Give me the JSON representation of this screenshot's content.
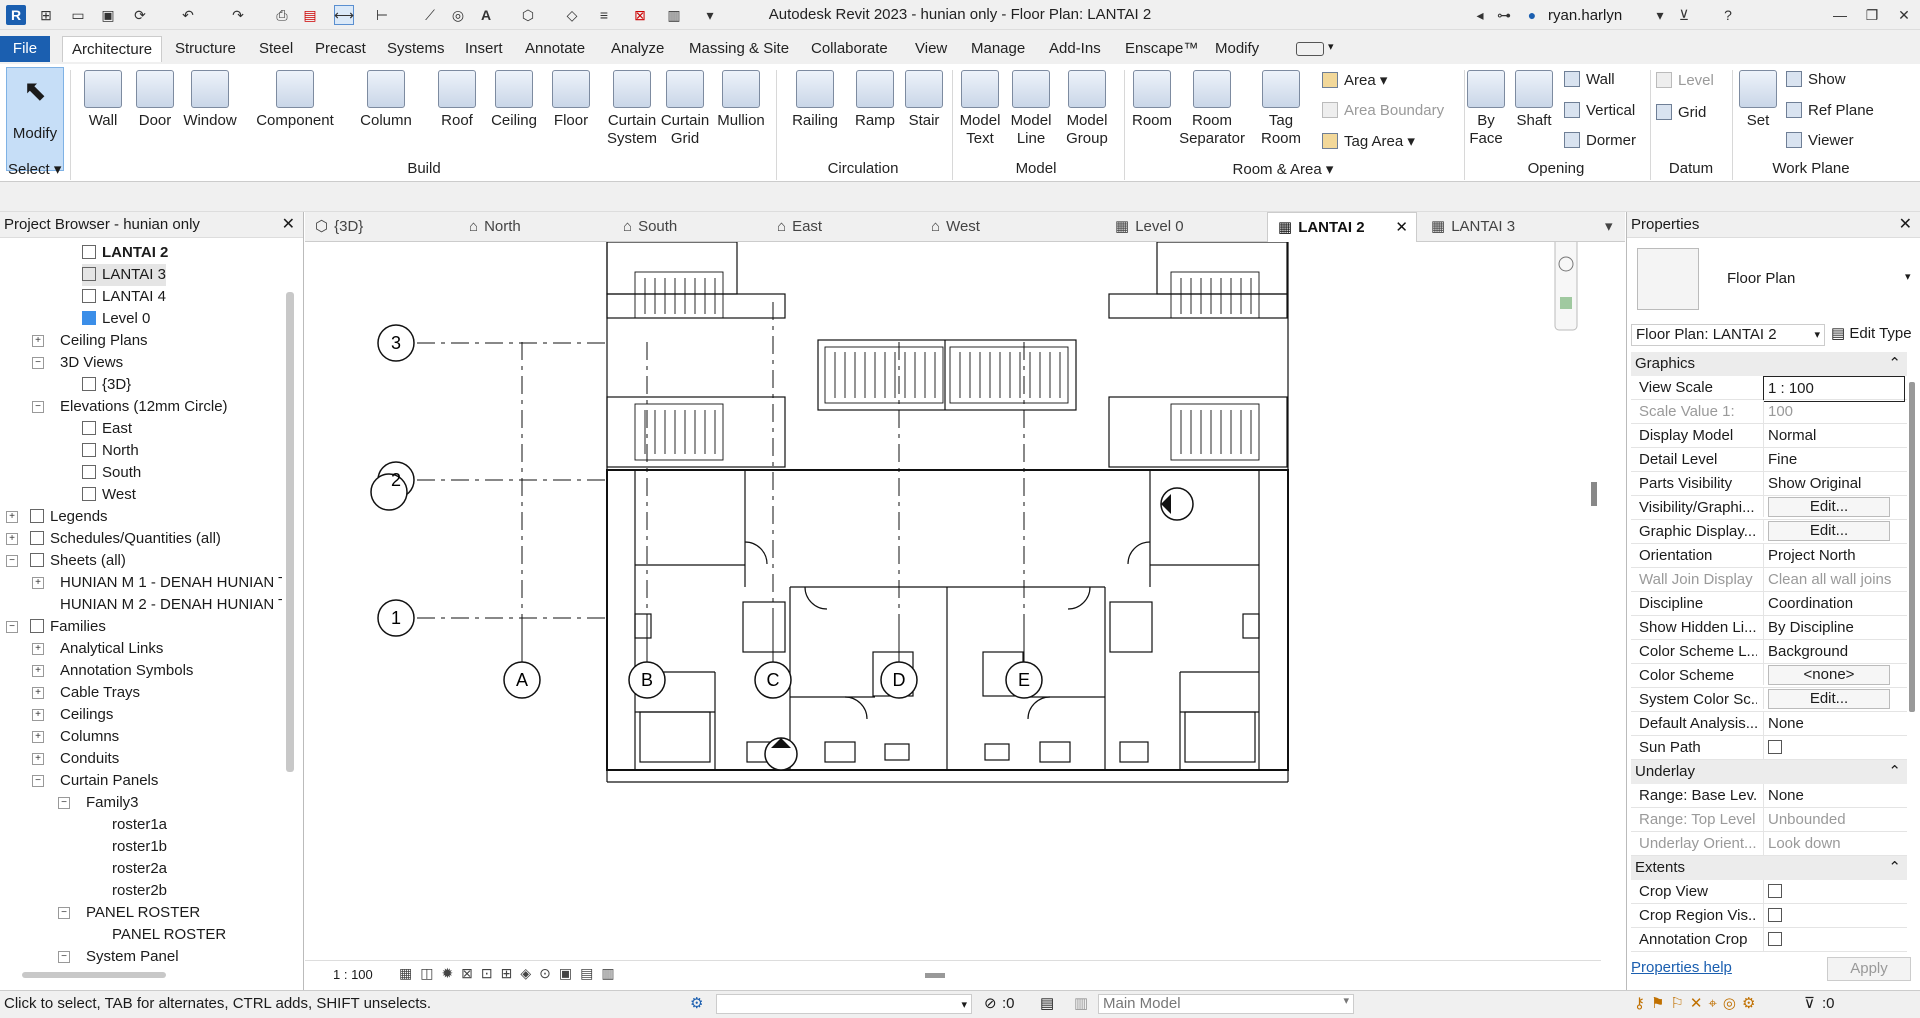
{
  "app": {
    "title": "Autodesk Revit 2023 - hunian only - Floor Plan: LANTAI 2",
    "user": "ryan.harlyn"
  },
  "ribbon_tabs": [
    "File",
    "Architecture",
    "Structure",
    "Steel",
    "Precast",
    "Systems",
    "Insert",
    "Annotate",
    "Analyze",
    "Massing & Site",
    "Collaborate",
    "View",
    "Manage",
    "Add-Ins",
    "Enscape™",
    "Modify"
  ],
  "active_tab": "Architecture",
  "ribbon": {
    "modify": "Modify",
    "select": "Select",
    "build": {
      "wall": "Wall",
      "door": "Door",
      "window": "Window",
      "component": "Component",
      "column": "Column",
      "roof": "Roof",
      "ceiling": "Ceiling",
      "floor": "Floor",
      "curtain_system": "Curtain System",
      "curtain_grid": "Curtain Grid",
      "mullion": "Mullion",
      "label": "Build"
    },
    "circulation": {
      "railing": "Railing",
      "ramp": "Ramp",
      "stair": "Stair",
      "label": "Circulation"
    },
    "model": {
      "model_text": "Model Text",
      "model_line": "Model Line",
      "model_group": "Model Group",
      "label": "Model"
    },
    "room_area": {
      "room": "Room",
      "room_separator": "Room Separator",
      "tag_room": "Tag Room",
      "area": "Area",
      "area_boundary": "Area Boundary",
      "tag_area": "Tag Area",
      "label": "Room & Area"
    },
    "opening": {
      "by_face": "By Face",
      "shaft": "Shaft",
      "wall": "Wall",
      "vertical": "Vertical",
      "dormer": "Dormer",
      "label": "Opening"
    },
    "datum": {
      "level": "Level",
      "grid": "Grid",
      "label": "Datum"
    },
    "work_plane": {
      "set": "Set",
      "show": "Show",
      "ref_plane": "Ref Plane",
      "viewer": "Viewer",
      "label": "Work Plane"
    }
  },
  "project_browser": {
    "title": "Project Browser - hunian only",
    "items": [
      {
        "label": "LANTAI 2",
        "bold": true
      },
      {
        "label": "LANTAI 3"
      },
      {
        "label": "LANTAI 4"
      },
      {
        "label": "Level 0"
      },
      {
        "label": "Ceiling Plans"
      },
      {
        "label": "3D Views"
      },
      {
        "label": "{3D}"
      },
      {
        "label": "Elevations (12mm Circle)"
      },
      {
        "label": "East"
      },
      {
        "label": "North"
      },
      {
        "label": "South"
      },
      {
        "label": "West"
      },
      {
        "label": "Legends"
      },
      {
        "label": "Schedules/Quantities (all)"
      },
      {
        "label": "Sheets (all)"
      },
      {
        "label": "HUNIAN M 1 - DENAH HUNIAN T"
      },
      {
        "label": "HUNIAN M 2 - DENAH HUNIAN T"
      },
      {
        "label": "Families"
      },
      {
        "label": "Analytical Links"
      },
      {
        "label": "Annotation Symbols"
      },
      {
        "label": "Cable Trays"
      },
      {
        "label": "Ceilings"
      },
      {
        "label": "Columns"
      },
      {
        "label": "Conduits"
      },
      {
        "label": "Curtain Panels"
      },
      {
        "label": "Family3"
      },
      {
        "label": "roster1a"
      },
      {
        "label": "roster1b"
      },
      {
        "label": "roster2a"
      },
      {
        "label": "roster2b"
      },
      {
        "label": "PANEL ROSTER"
      },
      {
        "label": "PANEL ROSTER"
      },
      {
        "label": "System Panel"
      }
    ]
  },
  "view_tabs": [
    "{3D}",
    "North",
    "South",
    "East",
    "West",
    "Level 0",
    "LANTAI 2",
    "LANTAI 3"
  ],
  "active_view": "LANTAI 2",
  "canvas": {
    "grid_rows": [
      "3",
      "2",
      "1"
    ],
    "grid_cols": [
      "A",
      "B",
      "C",
      "D",
      "E"
    ]
  },
  "view_scale": "1 : 100",
  "properties": {
    "title": "Properties",
    "type": "Floor Plan",
    "instance": "Floor Plan: LANTAI 2",
    "edit_type": "Edit Type",
    "sections": {
      "graphics": "Graphics",
      "underlay": "Underlay",
      "extents": "Extents"
    },
    "graphics_rows": [
      {
        "k": "View Scale",
        "v": "1 : 100"
      },
      {
        "k": "Scale Value    1:",
        "v": "100"
      },
      {
        "k": "Display Model",
        "v": "Normal"
      },
      {
        "k": "Detail Level",
        "v": "Fine"
      },
      {
        "k": "Parts Visibility",
        "v": "Show Original"
      },
      {
        "k": "Visibility/Graphi...",
        "v": "Edit..."
      },
      {
        "k": "Graphic Display...",
        "v": "Edit..."
      },
      {
        "k": "Orientation",
        "v": "Project North"
      },
      {
        "k": "Wall Join Display",
        "v": "Clean all wall joins"
      },
      {
        "k": "Discipline",
        "v": "Coordination"
      },
      {
        "k": "Show Hidden Li...",
        "v": "By Discipline"
      },
      {
        "k": "Color Scheme L...",
        "v": "Background"
      },
      {
        "k": "Color Scheme",
        "v": "<none>"
      },
      {
        "k": "System Color Sc...",
        "v": "Edit..."
      },
      {
        "k": "Default Analysis...",
        "v": "None"
      },
      {
        "k": "Sun Path",
        "v": ""
      }
    ],
    "underlay_rows": [
      {
        "k": "Range: Base Lev...",
        "v": "None"
      },
      {
        "k": "Range: Top Level",
        "v": "Unbounded"
      },
      {
        "k": "Underlay Orient...",
        "v": "Look down"
      }
    ],
    "extents_rows": [
      {
        "k": "Crop View",
        "v": ""
      },
      {
        "k": "Crop Region Vis...",
        "v": ""
      },
      {
        "k": "Annotation Crop",
        "v": ""
      }
    ],
    "help": "Properties help",
    "apply": "Apply"
  },
  "status": {
    "hint": "Click to select, TAB for alternates, CTRL adds, SHIFT unselects.",
    "workset": ":0",
    "model": "Main Model",
    "filter": ":0"
  },
  "colors": {
    "accent": "#1b5fb0",
    "selected_bg": "#c6def7"
  }
}
